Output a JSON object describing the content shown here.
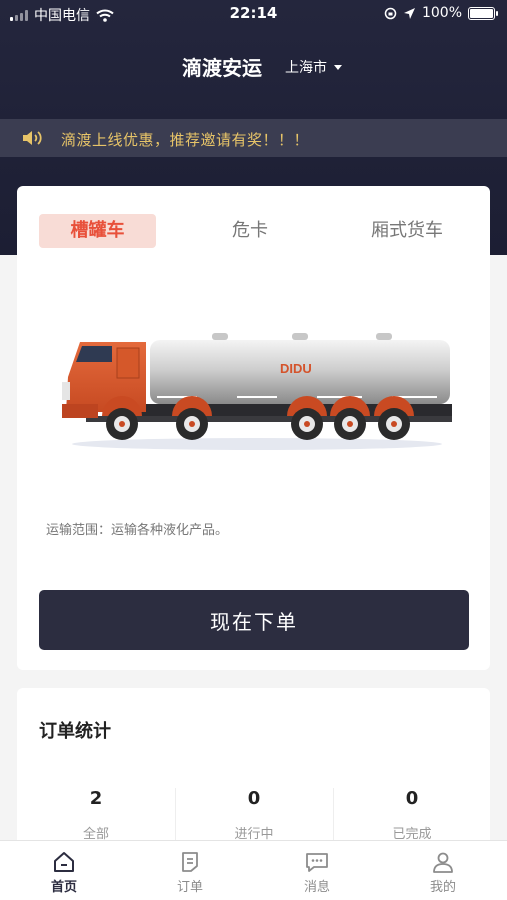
{
  "status_bar": {
    "carrier": "中国电信",
    "time": "22:14",
    "battery": "100%",
    "battery_level": 1.0
  },
  "header": {
    "title": "滴渡安运",
    "city": "上海市"
  },
  "notice": {
    "text": "滴渡上线优惠，推荐邀请有奖！！！"
  },
  "vehicle_tabs": [
    {
      "label": "槽罐车",
      "active": true
    },
    {
      "label": "危卡",
      "active": false
    },
    {
      "label": "厢式货车",
      "active": false
    }
  ],
  "truck": {
    "brand_text": "DIDU"
  },
  "transport_scope": "运输范围：运输各种液化产品。",
  "order_button": "现在下单",
  "order_stats": {
    "title": "订单统计",
    "items": [
      {
        "value": "2",
        "label": "全部"
      },
      {
        "value": "0",
        "label": "进行中"
      },
      {
        "value": "0",
        "label": "已完成"
      }
    ]
  },
  "tab_bar": [
    {
      "label": "首页",
      "icon": "home-icon",
      "active": true
    },
    {
      "label": "订单",
      "icon": "order-icon",
      "active": false
    },
    {
      "label": "消息",
      "icon": "message-icon",
      "active": false
    },
    {
      "label": "我的",
      "icon": "profile-icon",
      "active": false
    }
  ],
  "colors": {
    "header_bg": "#1f2137",
    "accent_red": "#e8503a",
    "notice_text": "#e7c468",
    "button_bg": "#2c2d40"
  }
}
